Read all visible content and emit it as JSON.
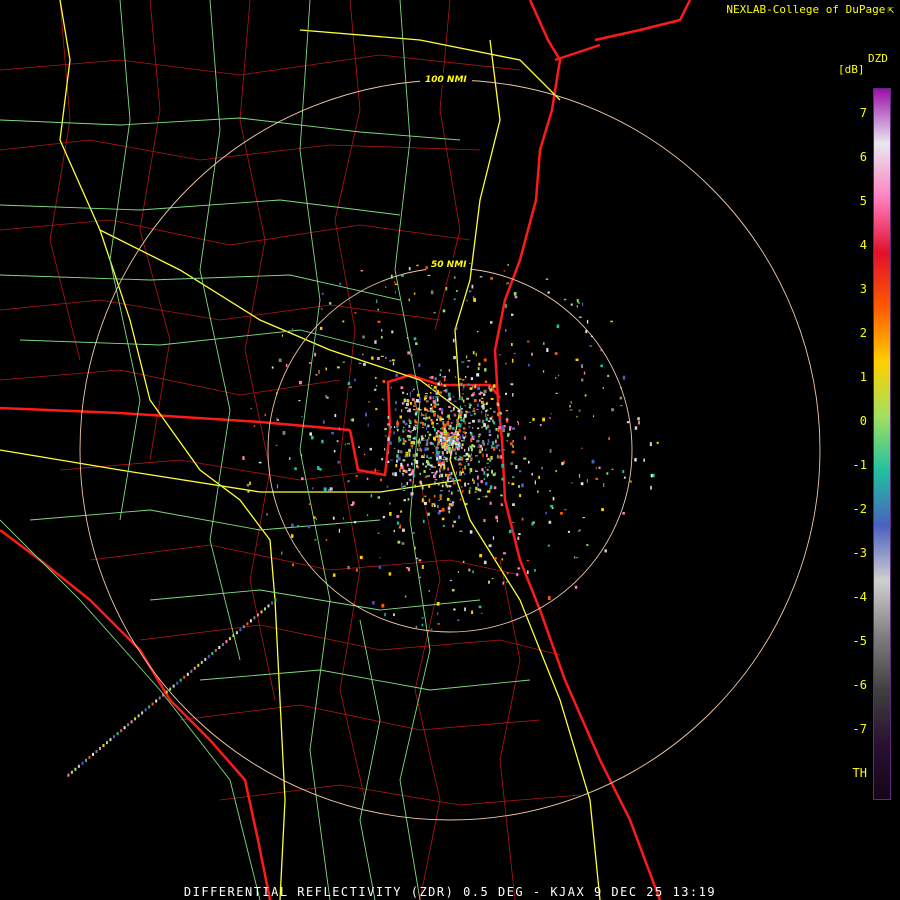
{
  "header": {
    "credit": "NEXLAB-College of DuPage",
    "credit_icon": "corner-arrow-icon"
  },
  "footer": {
    "caption": "DIFFERENTIAL REFLECTIVITY (ZDR) 0.5 DEG - KJAX 9 DEC 25 13:19"
  },
  "range_rings": {
    "inner_label": "50 NMI",
    "outer_label": "100 NMI"
  },
  "color_scale": {
    "product": "DZD",
    "unit": "[dB]",
    "ticks": [
      "7",
      "6",
      "5",
      "4",
      "3",
      "2",
      "1",
      "0",
      "-1",
      "-2",
      "-3",
      "-4",
      "-5",
      "-6",
      "-7",
      "TH"
    ],
    "colors": [
      "#9b0fa8",
      "#e8e8f0",
      "#ff7fbf",
      "#e0102a",
      "#ff5a00",
      "#ffd000",
      "#a0e060",
      "#20c0a0",
      "#4b60c0",
      "#d0d0d0",
      "#808080",
      "#404040",
      "#2a1030",
      "#140618"
    ]
  },
  "map_colors": {
    "state_lines": "#ff1a1a",
    "county_lines": "#c01818",
    "highways": "#ffff33",
    "roads": "#80e080",
    "rings": "#f0c8a8"
  }
}
